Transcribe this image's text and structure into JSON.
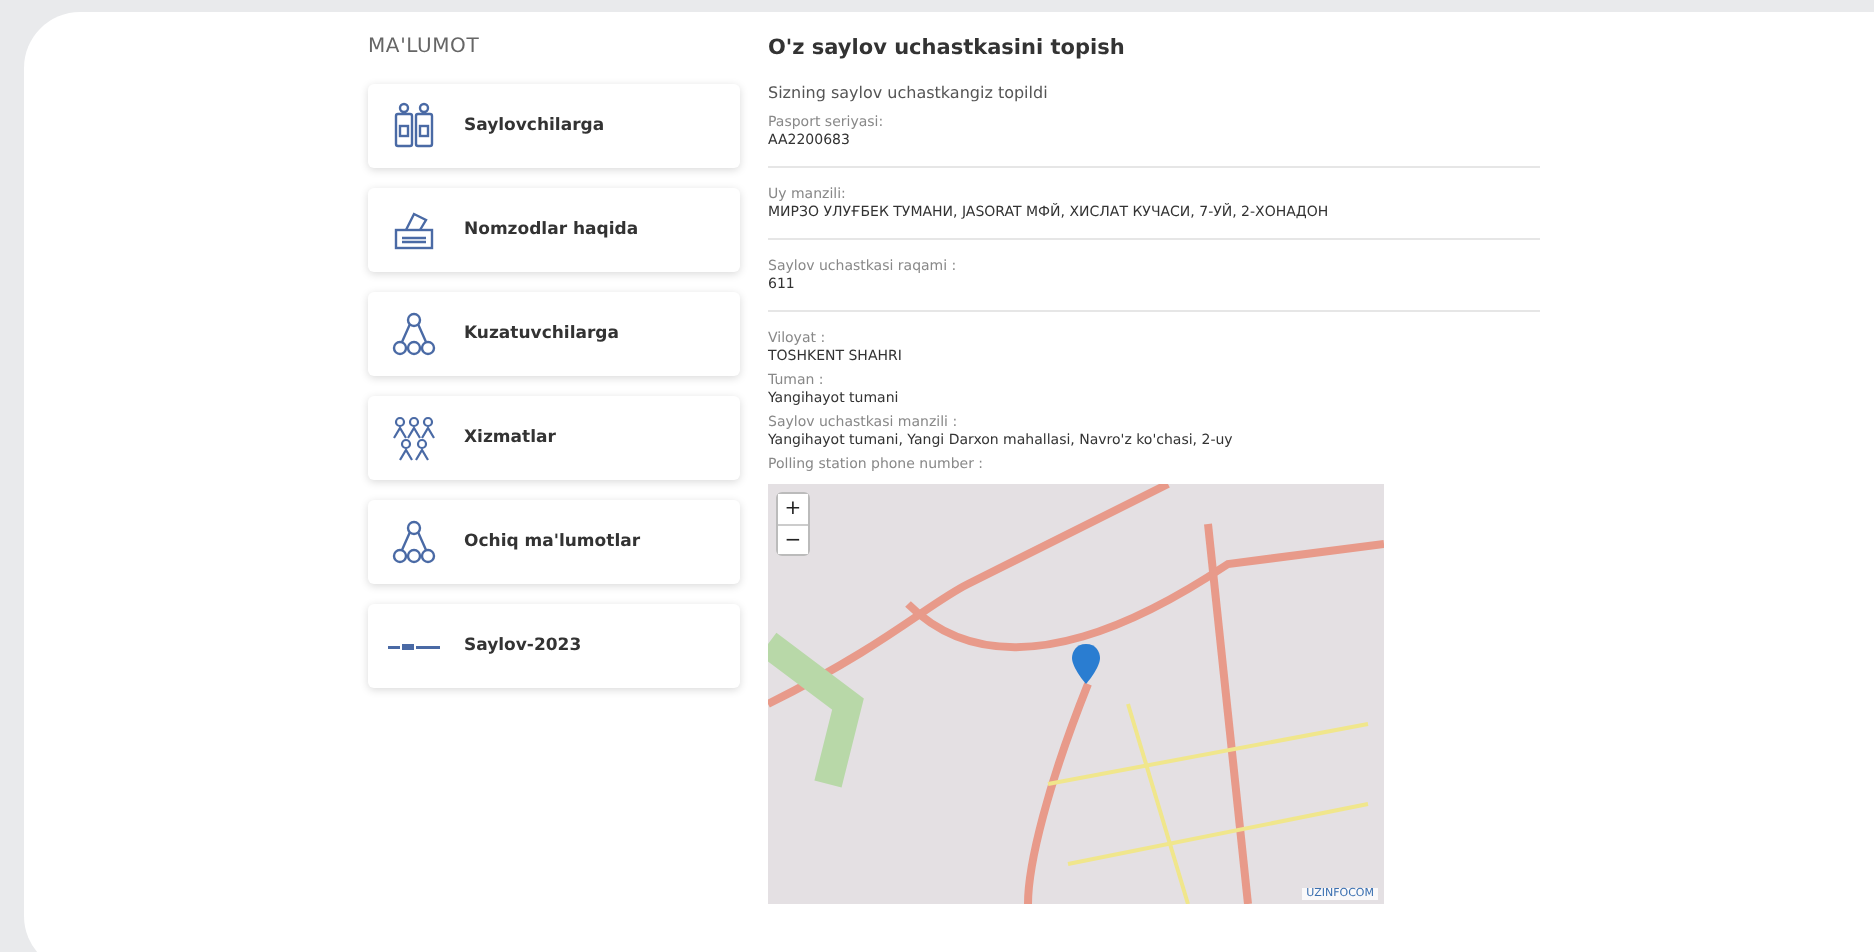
{
  "sidebar": {
    "title": "MA'LUMOT",
    "items": [
      {
        "label": "Saylovchilarga",
        "kind": "voters"
      },
      {
        "label": "Nomzodlar haqida",
        "kind": "ballot"
      },
      {
        "label": "Kuzatuvchilarga",
        "kind": "network"
      },
      {
        "label": "Xizmatlar",
        "kind": "group"
      },
      {
        "label": "Ochiq ma'lumotlar",
        "kind": "network"
      },
      {
        "label": "Saylov-2023",
        "kind": "logo"
      }
    ]
  },
  "main": {
    "title": "O'z saylov uchastkasini topish",
    "subtitle": "Sizning saylov uchastkangiz topildi",
    "fields": [
      {
        "label": "Pasport seriyasi:",
        "value": "AA2200683",
        "divider": true
      },
      {
        "label": "Uy manzili:",
        "value": "МИРЗО УЛУҒБЕК ТУМАНИ, JASORAT МФЙ, ХИСЛАТ КУЧАСИ, 7-УЙ, 2-ХОНАДОН",
        "divider": true
      },
      {
        "label": "Saylov uchastkasi raqami :",
        "value": "611",
        "divider": true
      },
      {
        "label": "Viloyat :",
        "value": "TOSHKENT SHAHRI",
        "divider": false
      },
      {
        "label": "Tuman :",
        "value": "Yangihayot tumani",
        "divider": false
      },
      {
        "label": "Saylov uchastkasi manzili :",
        "value": "Yangihayot tumani, Yangi Darxon mahallasi, Navro'z ko'chasi, 2-uy",
        "divider": false
      },
      {
        "label": "Polling station phone number :",
        "divider": false
      }
    ],
    "map": {
      "zoom_in": "+",
      "zoom_out": "−",
      "attribution": "UZINFOCOM"
    }
  }
}
